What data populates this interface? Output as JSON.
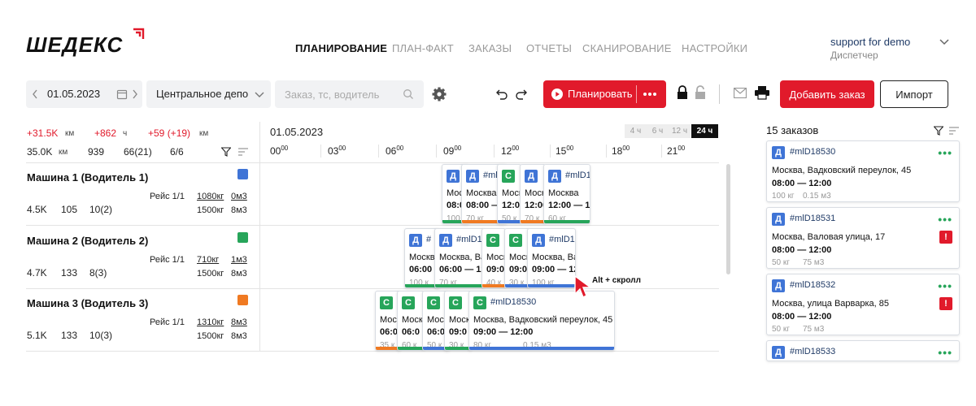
{
  "brand": {
    "name": "ШЕДЕКС",
    "accent": "#e11a2b"
  },
  "nav": {
    "items": [
      {
        "label": "ПЛАНИРОВАНИЕ",
        "active": true
      },
      {
        "label": "ПЛАН-ФАКТ",
        "active": false
      },
      {
        "label": "ЗАКАЗЫ",
        "active": false
      },
      {
        "label": "ОТЧЕТЫ",
        "active": false
      },
      {
        "label": "СКАНИРОВАНИЕ",
        "active": false
      },
      {
        "label": "НАСТРОЙКИ",
        "active": false
      }
    ]
  },
  "user": {
    "name": "support for demo",
    "role": "Диспетчер"
  },
  "toolbar": {
    "date": "01.05.2023",
    "depot": "Центральное депо",
    "search_placeholder": "Заказ, тс, водитель",
    "plan_label": "Планировать",
    "add_order_label": "Добавить заказ",
    "import_label": "Импорт"
  },
  "stats": {
    "delta": [
      "+31.5K",
      "км",
      "+862",
      "ч",
      "+59 (+19)",
      "км"
    ],
    "totals": [
      "35.0K",
      "км",
      "939",
      "66(21)",
      "6/6"
    ]
  },
  "timeline": {
    "date": "01.05.2023",
    "zoom": [
      {
        "label": "4 ч",
        "active": false
      },
      {
        "label": "6 ч",
        "active": false
      },
      {
        "label": "12 ч",
        "active": false
      },
      {
        "label": "24 ч",
        "active": true
      }
    ],
    "ticks": [
      {
        "h": "00",
        "m": "00"
      },
      {
        "h": "03",
        "m": "00"
      },
      {
        "h": "06",
        "m": "00"
      },
      {
        "h": "09",
        "m": "00"
      },
      {
        "h": "12",
        "m": "00"
      },
      {
        "h": "15",
        "m": "00"
      },
      {
        "h": "18",
        "m": "00"
      },
      {
        "h": "21",
        "m": "00"
      }
    ],
    "hint": "Alt + скролл"
  },
  "vehicles": [
    {
      "name": "Машина 1 (Водитель 1)",
      "color": "#3f74d6",
      "trip": "Рейс 1/1",
      "load": "1080кг",
      "cap": "1500кг",
      "vol": "0м3",
      "vcap": "8м3",
      "s1": "4.5K",
      "s2": "105",
      "s3": "10(2)"
    },
    {
      "name": "Машина 2 (Водитель 2)",
      "color": "#27a55a",
      "trip": "Рейс 1/1",
      "load": "710кг",
      "cap": "1500кг",
      "vol": "1м3",
      "vcap": "8м3",
      "s1": "4.7K",
      "s2": "133",
      "s3": "8(3)"
    },
    {
      "name": "Машина 3 (Водитель 3)",
      "color": "#f07a22",
      "trip": "Рейс 1/1",
      "load": "1310кг",
      "cap": "1500кг",
      "vol": "8м3",
      "vcap": "8м3",
      "s1": "5.1K",
      "s2": "133",
      "s3": "10(3)"
    }
  ],
  "cards": [
    {
      "t": "Д",
      "id": "#",
      "ad": "Москва",
      "tm": "08:0",
      "wt": "100",
      "bar": "#27a55a"
    },
    {
      "t": "Д",
      "id": "#mlD1",
      "ad": "Москва",
      "tm": "08:00 —",
      "wt": "70 кг",
      "bar": "#f07a22"
    },
    {
      "t": "С",
      "id": "",
      "ad": "Моск",
      "tm": "12:0",
      "wt": "50 к",
      "bar": "#3f74d6"
    },
    {
      "t": "Д",
      "id": "",
      "ad": "Моск",
      "tm": "12:00",
      "wt": "70 к",
      "bar": "#f07a22"
    },
    {
      "t": "Д",
      "id": "#mlD1",
      "ad": "Москва",
      "tm": "12:00 — 15",
      "wt": "60 кг",
      "bar": "#27a55a"
    },
    {
      "t": "Д",
      "id": "#",
      "ad": "Москва",
      "tm": "06:00",
      "wt": "100 к",
      "bar": "#27a55a"
    },
    {
      "t": "Д",
      "id": "#mlD1",
      "ad": "Москва, Ва",
      "tm": "06:00 — 12",
      "wt": "70 кг",
      "bar": "#27a55a"
    },
    {
      "t": "С",
      "id": "",
      "ad": "Моск",
      "tm": "09:0",
      "wt": "40 к",
      "bar": "#f07a22"
    },
    {
      "t": "С",
      "id": "",
      "ad": "Моск",
      "tm": "09:0",
      "wt": "30 к",
      "bar": "#3f74d6"
    },
    {
      "t": "Д",
      "id": "#mlD1",
      "ad": "Москва, Ва",
      "tm": "09:00 — 12",
      "wt": "100 кг",
      "bar": "#3f74d6"
    },
    {
      "t": "С",
      "id": "",
      "ad": "Моск",
      "tm": "06:0",
      "wt": "35 к",
      "bar": "#f07a22"
    },
    {
      "t": "С",
      "id": "",
      "ad": "Моск",
      "tm": "06:0",
      "wt": "60 к",
      "bar": "#27a55a"
    },
    {
      "t": "С",
      "id": "",
      "ad": "Моск",
      "tm": "06:0",
      "wt": "50 к",
      "bar": "#3f74d6"
    },
    {
      "t": "С",
      "id": "",
      "ad": "Моск",
      "tm": "09:0",
      "wt": "30 к",
      "bar": "#27a55a"
    },
    {
      "t": "С",
      "id": "#mlD18530",
      "ad": "Москва, Вадковский переулок, 45",
      "tm": "09:00 — 12:00",
      "wt": "80 кг",
      "wt2": "0.15 м3",
      "bar": "#3f74d6"
    }
  ],
  "sidebar": {
    "title": "15 заказов",
    "orders": [
      {
        "type": "Д",
        "id": "#mlD18530",
        "address": "Москва, Вадковский переулок, 45",
        "time": "08:00 — 12:00",
        "weight": "100 кг",
        "volume": "0.15 м3",
        "warn": false
      },
      {
        "type": "Д",
        "id": "#mlD18531",
        "address": "Москва, Валовая улица, 17",
        "time": "08:00 — 12:00",
        "weight": "50 кг",
        "volume": "75 м3",
        "warn": true
      },
      {
        "type": "Д",
        "id": "#mlD18532",
        "address": "Москва, улица Варварка, 85",
        "time": "08:00 — 12:00",
        "weight": "50 кг",
        "volume": "75 м3",
        "warn": true
      },
      {
        "type": "Д",
        "id": "#mlD18533",
        "address": "",
        "time": "",
        "weight": "",
        "volume": "",
        "warn": false
      }
    ]
  },
  "icons": [
    "calendar-icon",
    "chevron-left-icon",
    "chevron-right-icon",
    "chevron-down-icon",
    "search-icon",
    "gear-icon",
    "undo-icon",
    "redo-icon",
    "play-icon",
    "more-icon",
    "lock-icon",
    "unlock-icon",
    "mail-icon",
    "print-icon",
    "filter-icon",
    "sort-icon",
    "cursor-icon",
    "warning-icon"
  ]
}
